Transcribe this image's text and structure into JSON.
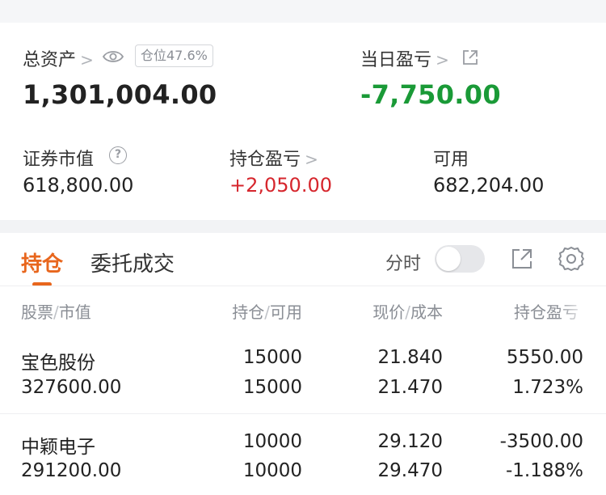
{
  "account": {
    "total_assets_label": "总资产",
    "chevron": ">",
    "position_ratio_badge": "仓位47.6%",
    "total_assets_value": "1,301,004.00",
    "daily_pnl_label": "当日盈亏",
    "daily_pnl_value": "-7,750.00",
    "securities_value_label": "证券市值",
    "help_mark": "?",
    "securities_value": "618,800.00",
    "holding_pnl_label": "持仓盈亏",
    "holding_pnl_value": "+2,050.00",
    "available_label": "可用",
    "available_value": "682,204.00"
  },
  "tabs": {
    "holdings": "持仓",
    "orders": "委托成交"
  },
  "toolbar": {
    "timeshare_label": "分时",
    "timeshare_on": false
  },
  "table": {
    "headers": {
      "stock": "股票",
      "market_value": "市值",
      "holding": "持仓",
      "available": "可用",
      "price": "现价",
      "cost": "成本",
      "pnl": "持仓盈亏",
      "separator": "/"
    },
    "rows": [
      {
        "name": "宝色股份",
        "market_value": "327600.00",
        "holding": "15000",
        "available": "15000",
        "price": "21.840",
        "cost": "21.470",
        "pnl": "5550.00",
        "pnl_pct": "1.723%",
        "direction": "up"
      },
      {
        "name": "中颖电子",
        "market_value": "291200.00",
        "holding": "10000",
        "available": "10000",
        "price": "29.120",
        "cost": "29.470",
        "pnl": "-3500.00",
        "pnl_pct": "-1.188%",
        "direction": "down"
      }
    ]
  },
  "colors": {
    "up": "#d6262d",
    "down": "#1a9a37",
    "accent": "#e8661d"
  }
}
